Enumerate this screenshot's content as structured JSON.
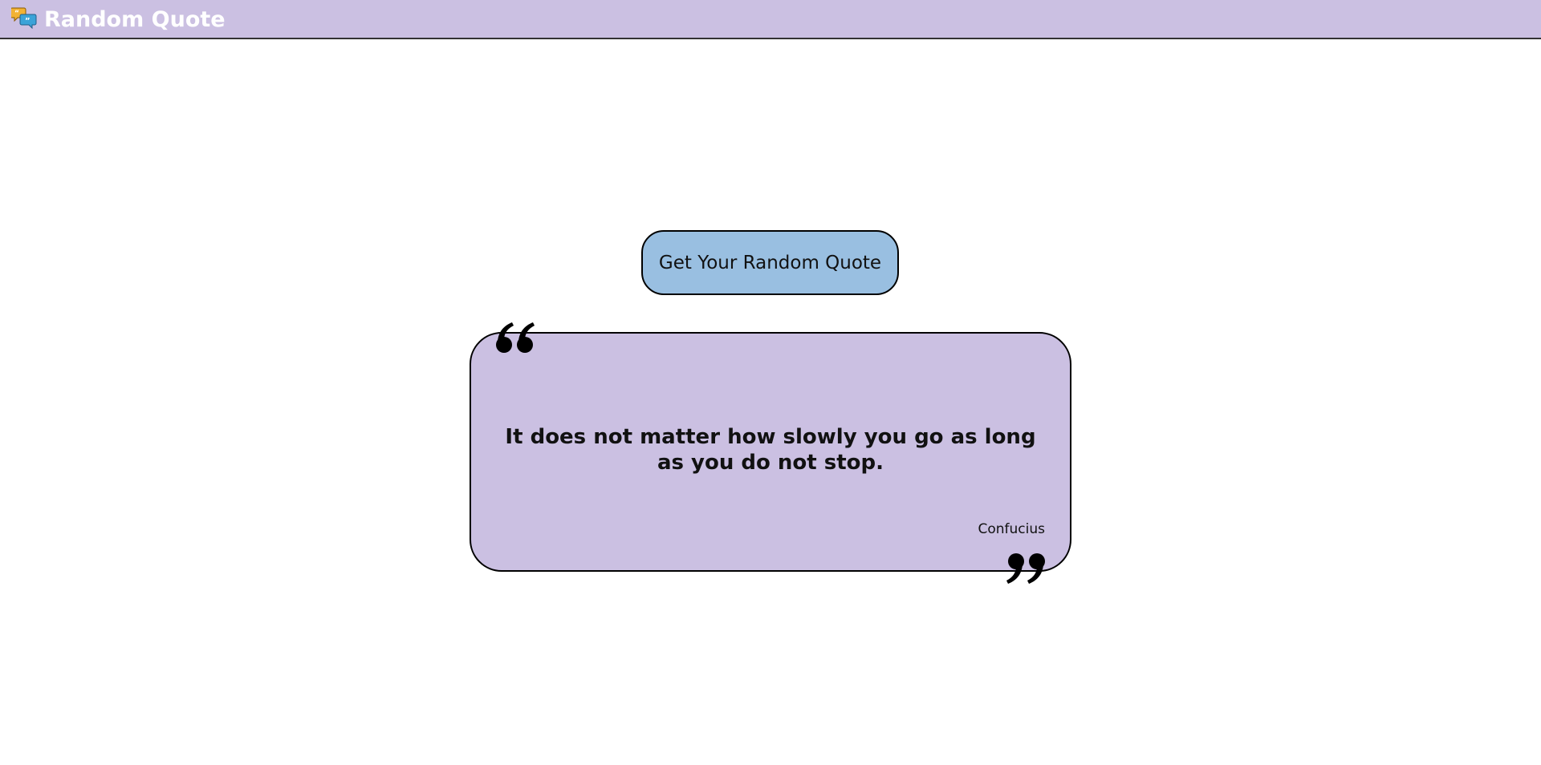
{
  "header": {
    "title": "Random Quote",
    "logo_icon": "quote-bubbles-icon",
    "background": "#cbc0e2"
  },
  "main": {
    "button_label": "Get Your Random Quote",
    "button_color": "#99bfe1",
    "card_color": "#cbc0e2",
    "quote": {
      "text": "It does not matter how slowly you go as long as you do not stop.",
      "author": "Confucius",
      "open_icon": "open-quote-icon",
      "close_icon": "close-quote-icon"
    }
  }
}
